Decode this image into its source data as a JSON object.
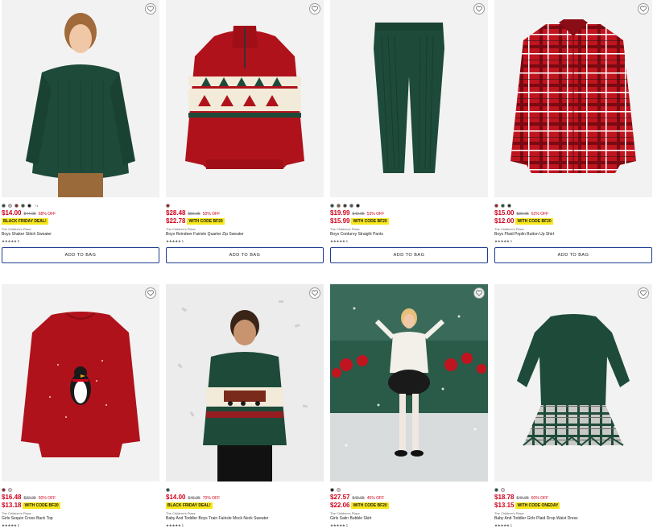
{
  "products": [
    {
      "name": "Boys Shaker Stitch Sweater",
      "brand": "The Children's Place",
      "price": "$14.00",
      "original_price": "$44.95",
      "discount": "68% OFF",
      "promo_price": "",
      "promo_badge": "BLACK FRIDAY DEAL!",
      "swatches": [
        "#1e4a3a",
        "#c7c2b8",
        "#8b1a1a",
        "#3a4a3a",
        "#111111"
      ],
      "more_colors": "+1",
      "rating_count": "2",
      "add_to_bag": "ADD TO BAG",
      "wishlist_icon": "heart-icon"
    },
    {
      "name": "Boys Reindeer Fairisle Quarter Zip Sweater",
      "brand": "The Children's Place",
      "price": "$28.48",
      "original_price": "$56.95",
      "discount": "50% OFF",
      "promo_price": "$22.78",
      "promo_badge": "WITH CODE BF20",
      "swatches": [
        "#b0121b"
      ],
      "more_colors": "",
      "rating_count": "1",
      "add_to_bag": "ADD TO BAG",
      "wishlist_icon": "heart-icon"
    },
    {
      "name": "Boys Corduroy Straight Pants",
      "brand": "The Children's Place",
      "price": "$19.99",
      "original_price": "$42.95",
      "discount": "53% OFF",
      "promo_price": "$15.99",
      "promo_badge": "WITH CODE BF20",
      "swatches": [
        "#1e4a3a",
        "#7a5a3a",
        "#333333",
        "#555555",
        "#111111"
      ],
      "more_colors": "",
      "rating_count": "1",
      "add_to_bag": "ADD TO BAG",
      "wishlist_icon": "heart-icon"
    },
    {
      "name": "Boys Plaid Poplin Button Up Shirt",
      "brand": "The Children's Place",
      "price": "$15.00",
      "original_price": "$39.95",
      "discount": "62% OFF",
      "promo_price": "$12.00",
      "promo_badge": "WITH CODE BF20",
      "swatches": [
        "#b0121b",
        "#1e4a3a",
        "#2a2a2a"
      ],
      "more_colors": "",
      "rating_count": "1",
      "add_to_bag": "ADD TO BAG",
      "wishlist_icon": "heart-icon"
    },
    {
      "name": "Girls Sequin Cross Back Top",
      "brand": "The Children's Place",
      "price": "$16.48",
      "original_price": "$32.95",
      "discount": "50% OFF",
      "promo_price": "$13.18",
      "promo_badge": "WITH CODE BF20",
      "swatches": [
        "#b0121b",
        "#f0d0d8"
      ],
      "more_colors": "",
      "rating_count": "2",
      "add_to_bag": "",
      "wishlist_icon": "heart-icon"
    },
    {
      "name": "Baby And Toddler Boys Train Fairisle Mock Neck Sweater",
      "brand": "The Children's Place",
      "price": "$14.00",
      "original_price": "$46.95",
      "discount": "70% OFF",
      "promo_price": "",
      "promo_badge": "BLACK FRIDAY DEAL!",
      "swatches": [
        "#1e4a3a"
      ],
      "more_colors": "",
      "rating_count": "1",
      "add_to_bag": "",
      "wishlist_icon": "heart-icon"
    },
    {
      "name": "Girls Satin Bubble Skirt",
      "brand": "The Children's Place",
      "price": "$27.57",
      "original_price": "$49.95",
      "discount": "45% OFF",
      "promo_price": "$22.06",
      "promo_badge": "WITH CODE BF20",
      "swatches": [
        "#111111",
        "#f0d0d8"
      ],
      "more_colors": "",
      "rating_count": "1",
      "add_to_bag": "",
      "wishlist_icon": "heart-icon"
    },
    {
      "name": "Baby And Toddler Girls Plaid Drop Waist Dress",
      "brand": "The Children's Place",
      "price": "$18.78",
      "original_price": "$46.95",
      "discount": "60% OFF",
      "promo_price": "$13.15",
      "promo_badge": "WITH CODE ONEDAY",
      "swatches": [
        "#1e4a3a",
        "#f0d0d8"
      ],
      "more_colors": "",
      "rating_count": "1",
      "add_to_bag": "",
      "wishlist_icon": "heart-icon"
    }
  ],
  "colors": {
    "sale_red": "#d0021b",
    "badge_yellow": "#f8e71c",
    "button_border": "#1d3d8f"
  }
}
